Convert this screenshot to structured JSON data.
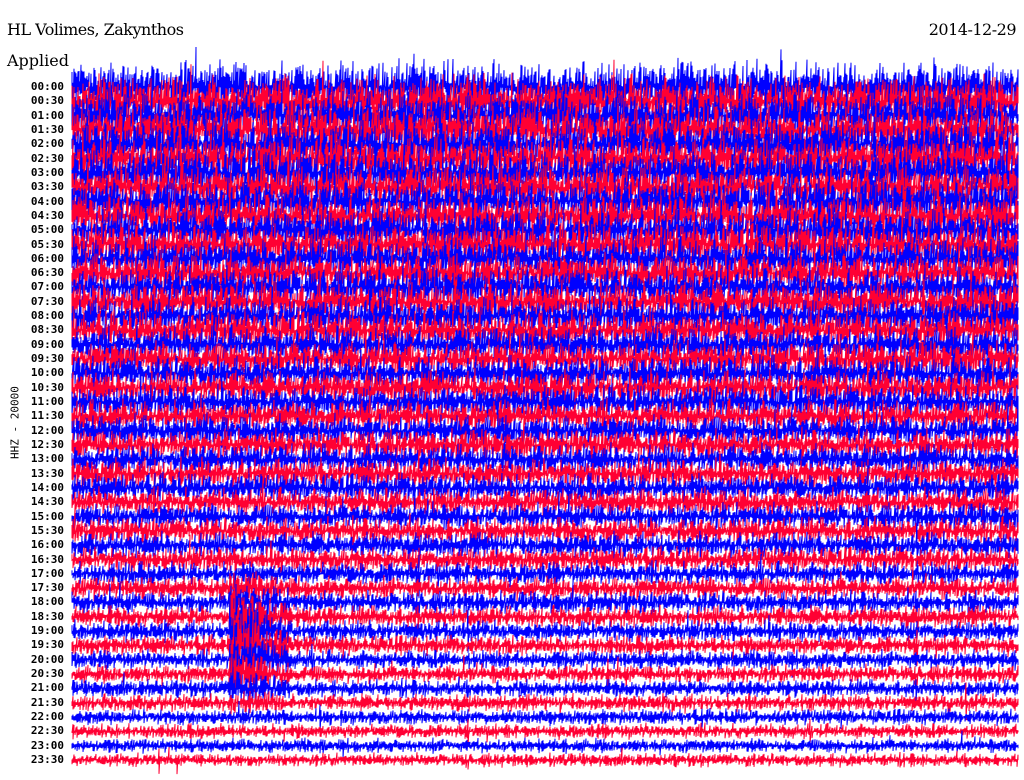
{
  "header": {
    "station": "HL Volimes, Zakynthos",
    "date": "2014-12-29",
    "filter_label": "Applied"
  },
  "chart_data": {
    "type": "line",
    "title": "HL Volimes, Zakynthos",
    "date": "2014-12-29",
    "ylabel": "HHZ - 20000",
    "xlabel": "",
    "row_minutes": 30,
    "row_labels": [
      "00:00",
      "00:30",
      "01:00",
      "01:30",
      "02:00",
      "02:30",
      "03:00",
      "03:30",
      "04:00",
      "04:30",
      "05:00",
      "05:30",
      "06:00",
      "06:30",
      "07:00",
      "07:30",
      "08:00",
      "08:30",
      "09:00",
      "09:30",
      "10:00",
      "10:30",
      "11:00",
      "11:30",
      "12:00",
      "12:30",
      "13:00",
      "13:30",
      "14:00",
      "14:30",
      "15:00",
      "15:30",
      "16:00",
      "16:30",
      "17:00",
      "17:30",
      "18:00",
      "18:30",
      "19:00",
      "19:30",
      "20:00",
      "20:30",
      "21:00",
      "21:30",
      "22:00",
      "22:30",
      "23:00",
      "23:30"
    ],
    "series_colors": [
      "#0000ff",
      "#ff0033"
    ],
    "event": {
      "start_row": "16:00",
      "peak_row": "19:30",
      "end_row": "23:30",
      "minute_offset": 5
    }
  }
}
